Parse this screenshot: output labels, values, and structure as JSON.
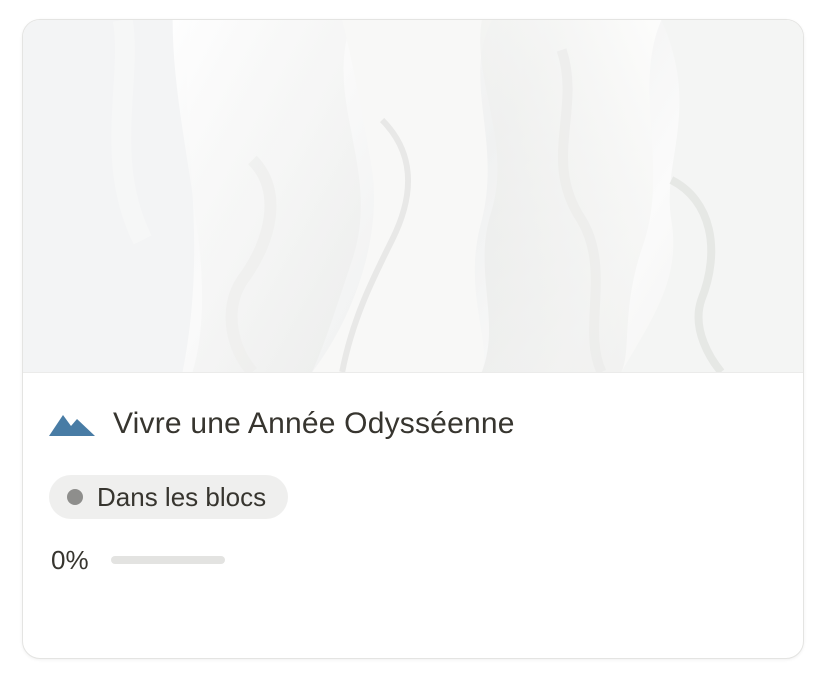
{
  "card": {
    "title": "Vivre une Année Odysséenne",
    "icon": "mountains-icon",
    "icon_color": "#487ca5",
    "status": {
      "label": "Dans les blocs",
      "dot_color": "#8e8e8c"
    },
    "progress": {
      "label": "0%",
      "fraction": 0
    }
  }
}
